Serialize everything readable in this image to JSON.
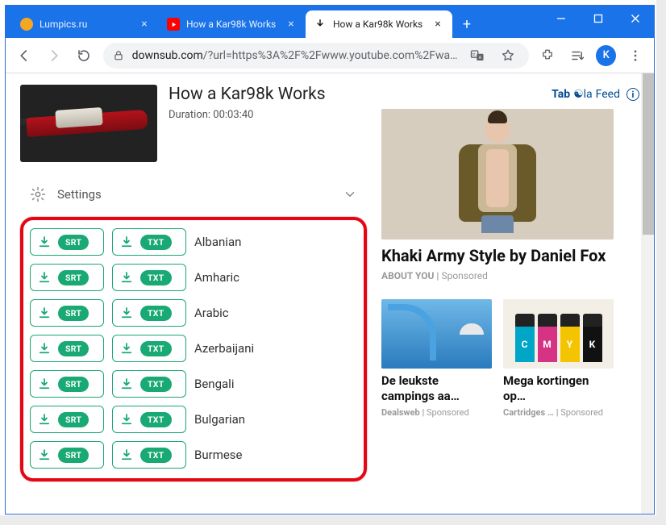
{
  "window": {
    "tabs": [
      {
        "title": "Lumpics.ru",
        "favicon_color": "#f5a623",
        "active": false
      },
      {
        "title": "How a Kar98k Works",
        "favicon_type": "youtube",
        "active": false
      },
      {
        "title": "How a Kar98k Works",
        "favicon_type": "downsub",
        "active": true
      }
    ],
    "avatar_letter": "K"
  },
  "toolbar": {
    "url_host": "downsub.com",
    "url_rest": "/?url=https%3A%2F%2Fwww.youtube.com%2Fwa…"
  },
  "video": {
    "title": "How a Kar98k Works",
    "duration_label": "Duration: 00:03:40"
  },
  "settings": {
    "label": "Settings"
  },
  "download_labels": {
    "srt": "SRT",
    "txt": "TXT"
  },
  "languages": [
    "Albanian",
    "Amharic",
    "Arabic",
    "Azerbaijani",
    "Bengali",
    "Bulgarian",
    "Burmese"
  ],
  "taboola": {
    "brand_bold": "Tab",
    "brand_rest_script": "☯la",
    "brand_tail": " Feed",
    "main": {
      "title": "Khaki Army Style by Daniel Fox",
      "source": "ABOUT YOU",
      "sponsored": "Sponsored"
    },
    "small": [
      {
        "title": "De leukste campings aa…",
        "source": "Dealsweb",
        "sponsored": "Sponsored"
      },
      {
        "title": "Mega kortingen op…",
        "source": "Cartridges …",
        "sponsored": "Sponsored"
      }
    ],
    "ink_colors": [
      {
        "c": "#00a6c7",
        "l": "C"
      },
      {
        "c": "#d63384",
        "l": "M"
      },
      {
        "c": "#f5c400",
        "l": "Y"
      },
      {
        "c": "#111",
        "l": "K"
      }
    ]
  }
}
